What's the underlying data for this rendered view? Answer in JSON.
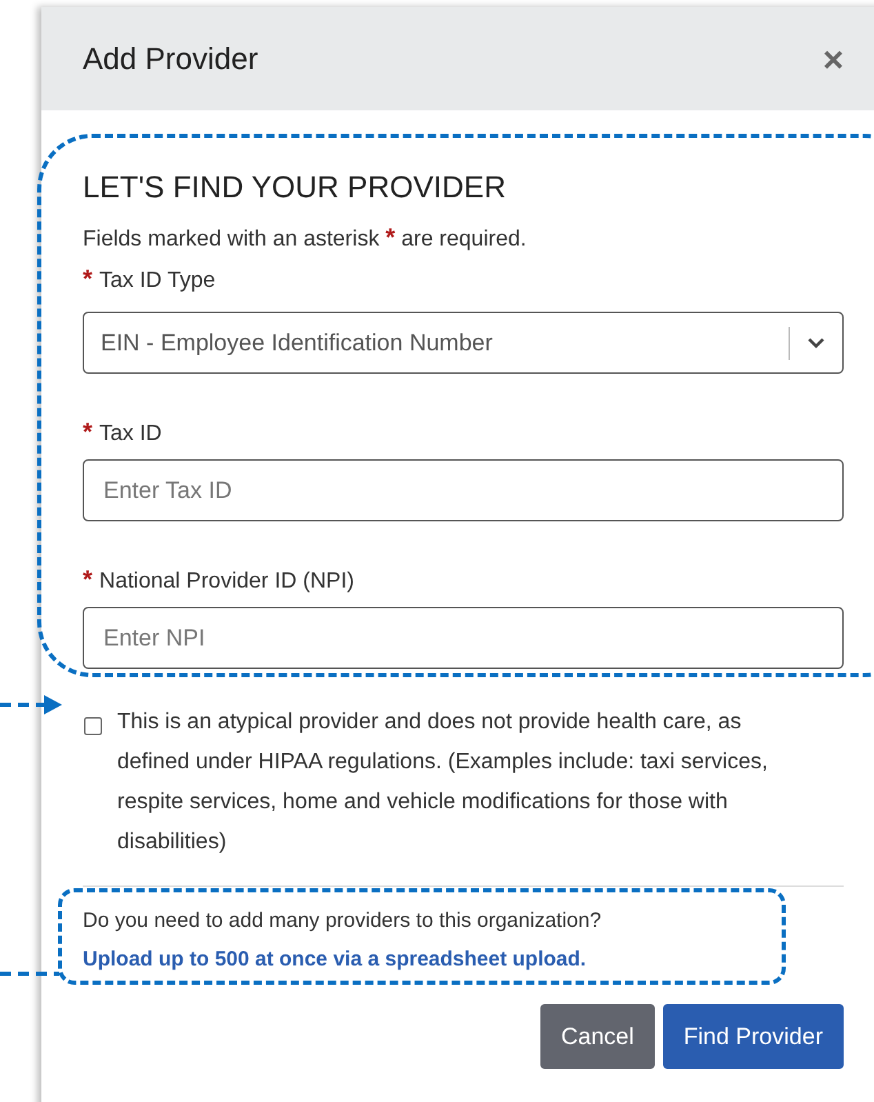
{
  "dialog": {
    "title": "Add Provider",
    "close": "×"
  },
  "heading": "LET'S FIND YOUR PROVIDER",
  "required_note": {
    "before": "Fields marked with an asterisk",
    "asterisk": "*",
    "after": "are required."
  },
  "fields": [
    {
      "kind": "select",
      "label": "Tax ID Type",
      "required": true,
      "value": "EIN - Employee Identification Number"
    },
    {
      "kind": "text",
      "label": "Tax ID",
      "required": true,
      "placeholder": "Enter Tax ID"
    },
    {
      "kind": "text",
      "label": "National Provider ID (NPI)",
      "required": true,
      "placeholder": "Enter NPI"
    }
  ],
  "atypical": {
    "checked": false,
    "label": "This is an atypical provider and does not provide health care, as defined under HIPAA regulations. (Examples include: taxi services, respite services, home and vehicle modifications for those with disabilities)"
  },
  "bulk_upload": {
    "question": "Do you need to add many providers to this organization?",
    "link": "Upload up to 500 at once via a spreadsheet upload."
  },
  "buttons": [
    {
      "kind": "secondary",
      "label": "Cancel"
    },
    {
      "kind": "primary",
      "label": "Find Provider"
    }
  ]
}
